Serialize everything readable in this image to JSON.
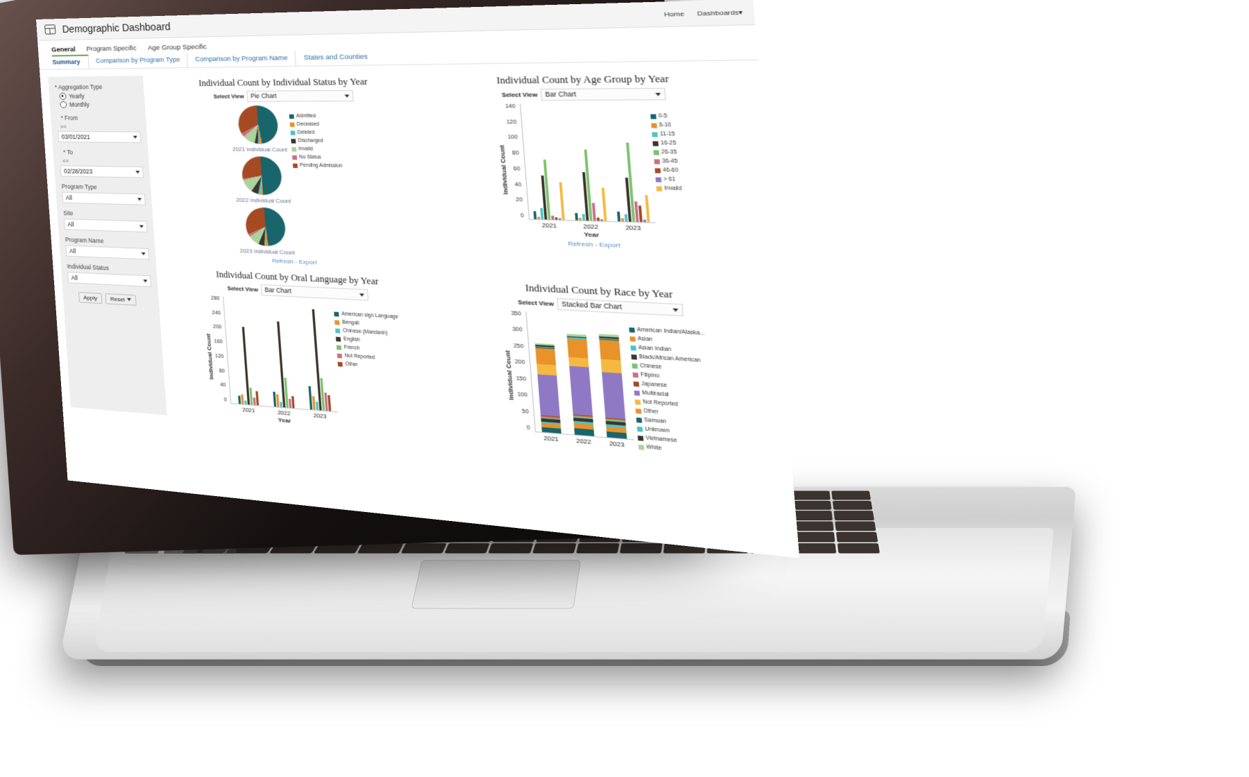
{
  "app": {
    "title": "Demographic Dashboard",
    "icon": "dashboard-grid-icon",
    "nav": {
      "home": "Home",
      "dashboards": "Dashboards",
      "caret": "▾"
    }
  },
  "tabs_primary": [
    {
      "label": "General",
      "active": true
    },
    {
      "label": "Program Specific",
      "active": false
    },
    {
      "label": "Age Group Specific",
      "active": false
    }
  ],
  "tabs_secondary": [
    {
      "label": "Summary",
      "active": true
    },
    {
      "label": "Comparison by Program Type",
      "active": false
    },
    {
      "label": "Comparison by Program Name",
      "active": false
    },
    {
      "label": "States and Counties",
      "active": false
    }
  ],
  "filters": {
    "aggregation_label": "* Aggregation Type",
    "aggregation_options": [
      {
        "label": "Yearly",
        "selected": true
      },
      {
        "label": "Monthly",
        "selected": false
      }
    ],
    "from_label": "* From",
    "from_operator": ">=",
    "from_value": "03/01/2021",
    "to_label": "* To",
    "to_operator": "<=",
    "to_value": "02/28/2023",
    "program_type_label": "Program Type",
    "program_type_value": "All",
    "site_label": "Site",
    "site_value": "All",
    "program_name_label": "Program Name",
    "program_name_value": "All",
    "individual_status_label": "Individual Status",
    "individual_status_value": "All",
    "apply_label": "Apply",
    "reset_label": "Reset"
  },
  "select_view_label": "Select View",
  "refresh_label": "Refresh",
  "export_label": "Export",
  "chart_data": [
    {
      "id": "status_pie",
      "type": "pie",
      "title": "Individual Count by Individual Status by Year",
      "view": "Pie Chart",
      "legend_position": "right",
      "legend": [
        {
          "name": "Admitted",
          "color": "#18656b"
        },
        {
          "name": "Deceased",
          "color": "#e8922a"
        },
        {
          "name": "Deleted",
          "color": "#4cc3c9"
        },
        {
          "name": "Discharged",
          "color": "#3b342e"
        },
        {
          "name": "Invalid",
          "color": "#a9d49a"
        },
        {
          "name": "No Status",
          "color": "#c96f86"
        },
        {
          "name": "Pending Admission",
          "color": "#a54a23"
        }
      ],
      "pies": [
        {
          "caption": "2021 Individual Count",
          "values": [
            {
              "name": "Admitted",
              "value": 48
            },
            {
              "name": "Deceased",
              "value": 2
            },
            {
              "name": "Deleted",
              "value": 1
            },
            {
              "name": "Discharged",
              "value": 3
            },
            {
              "name": "Invalid",
              "value": 10
            },
            {
              "name": "No Status",
              "value": 3
            },
            {
              "name": "Pending Admission",
              "value": 33
            }
          ]
        },
        {
          "caption": "2022 Individual Count",
          "values": [
            {
              "name": "Admitted",
              "value": 50
            },
            {
              "name": "Deceased",
              "value": 2
            },
            {
              "name": "Deleted",
              "value": 2
            },
            {
              "name": "Discharged",
              "value": 6
            },
            {
              "name": "Invalid",
              "value": 11
            },
            {
              "name": "No Status",
              "value": 1
            },
            {
              "name": "Pending Admission",
              "value": 28
            }
          ]
        },
        {
          "caption": "2023 Individual Count",
          "values": [
            {
              "name": "Admitted",
              "value": 49
            },
            {
              "name": "Deceased",
              "value": 2
            },
            {
              "name": "Deleted",
              "value": 1
            },
            {
              "name": "Discharged",
              "value": 5
            },
            {
              "name": "Invalid",
              "value": 9
            },
            {
              "name": "No Status",
              "value": 2
            },
            {
              "name": "Pending Admission",
              "value": 32
            }
          ]
        }
      ]
    },
    {
      "id": "agegroup_bar",
      "type": "bar",
      "title": "Individual Count by Age Group by Year",
      "view": "Bar Chart",
      "xlabel": "Year",
      "ylabel": "Individual Count",
      "ylim": [
        0,
        140
      ],
      "yticks": [
        140,
        120,
        100,
        80,
        60,
        40,
        20,
        0
      ],
      "categories": [
        "2021",
        "2022",
        "2023"
      ],
      "series": [
        {
          "name": "0-5",
          "color": "#18656b",
          "values": [
            10,
            9,
            12
          ]
        },
        {
          "name": "6-10",
          "color": "#e8922a",
          "values": [
            3,
            3,
            4
          ]
        },
        {
          "name": "11-15",
          "color": "#4cc3c9",
          "values": [
            14,
            8,
            9
          ]
        },
        {
          "name": "16-25",
          "color": "#3b342e",
          "values": [
            53,
            58,
            52
          ]
        },
        {
          "name": "26-35",
          "color": "#7cc36b",
          "values": [
            72,
            85,
            94
          ]
        },
        {
          "name": "36-45",
          "color": "#c96f86",
          "values": [
            5,
            21,
            24
          ]
        },
        {
          "name": "46-60",
          "color": "#a54a23",
          "values": [
            3,
            4,
            19
          ]
        },
        {
          "name": "> 61",
          "color": "#8f79c4",
          "values": [
            2,
            2,
            3
          ]
        },
        {
          "name": "Invalid",
          "color": "#f5b942",
          "values": [
            45,
            40,
            32
          ]
        }
      ]
    },
    {
      "id": "orallanguage_bar",
      "type": "bar",
      "title": "Individual Count by Oral Language by Year",
      "view": "Bar Chart",
      "xlabel": "Year",
      "ylabel": "Individual Count",
      "ylim": [
        0,
        280
      ],
      "yticks": [
        280,
        240,
        200,
        160,
        120,
        80,
        40,
        0
      ],
      "categories": [
        "2021",
        "2022",
        "2023"
      ],
      "legend": [
        {
          "name": "American sign Language",
          "color": "#18656b"
        },
        {
          "name": "Bengali",
          "color": "#e8922a"
        },
        {
          "name": "Chinese (Mandarin)",
          "color": "#4cc3c9"
        },
        {
          "name": "English",
          "color": "#3b342e"
        },
        {
          "name": "French",
          "color": "#7cc36b"
        },
        {
          "name": "Not Reported",
          "color": "#c96f86"
        },
        {
          "name": "Other",
          "color": "#a54a23"
        }
      ],
      "series": [
        {
          "name": "American sign Language",
          "color": "#18656b",
          "values": [
            22,
            38,
            60
          ]
        },
        {
          "name": "Bengali",
          "color": "#e8922a",
          "values": [
            26,
            32,
            34
          ]
        },
        {
          "name": "Chinese (Mandarin)",
          "color": "#4cc3c9",
          "values": [
            10,
            14,
            22
          ]
        },
        {
          "name": "English",
          "color": "#3b342e",
          "values": [
            202,
            222,
            258
          ]
        },
        {
          "name": "French",
          "color": "#7cc36b",
          "values": [
            44,
            78,
            84
          ]
        },
        {
          "name": "Not Reported",
          "color": "#c96f86",
          "values": [
            20,
            24,
            46
          ]
        },
        {
          "name": "Other",
          "color": "#a54a23",
          "values": [
            36,
            30,
            40
          ]
        }
      ]
    },
    {
      "id": "race_stacked",
      "type": "bar",
      "title": "Individual Count by Race by Year",
      "view": "Stacked Bar Chart",
      "stacked": true,
      "xlabel": "",
      "ylabel": "Individual Count",
      "ylim": [
        0,
        350
      ],
      "yticks": [
        350,
        300,
        250,
        200,
        150,
        100,
        50,
        0
      ],
      "categories": [
        "2021",
        "2022",
        "2023"
      ],
      "series": [
        {
          "name": "American Indian/Alaska...",
          "color": "#18656b",
          "values": [
            14,
            18,
            17
          ]
        },
        {
          "name": "Asian",
          "color": "#e8922a",
          "values": [
            12,
            14,
            14
          ]
        },
        {
          "name": "Asian Indian",
          "color": "#4cc3c9",
          "values": [
            5,
            7,
            6
          ]
        },
        {
          "name": "Black/African American",
          "color": "#3b342e",
          "values": [
            8,
            10,
            9
          ]
        },
        {
          "name": "Chinese",
          "color": "#7cc36b",
          "values": [
            4,
            5,
            5
          ]
        },
        {
          "name": "Filipino",
          "color": "#c96f86",
          "values": [
            3,
            3,
            3
          ]
        },
        {
          "name": "Japanese",
          "color": "#a54a23",
          "values": [
            2,
            2,
            2
          ]
        },
        {
          "name": "Multiracial",
          "color": "#8f79c4",
          "values": [
            120,
            140,
            132
          ]
        },
        {
          "name": "Not Reported",
          "color": "#f5b942",
          "values": [
            30,
            26,
            36
          ]
        },
        {
          "name": "Other",
          "color": "#e8922a",
          "values": [
            48,
            52,
            56
          ]
        },
        {
          "name": "Samoan",
          "color": "#18656b",
          "values": [
            2,
            2,
            2
          ]
        },
        {
          "name": "Unknown",
          "color": "#4cc3c9",
          "values": [
            3,
            3,
            3
          ]
        },
        {
          "name": "Vietnamese",
          "color": "#3b342e",
          "values": [
            3,
            4,
            4
          ]
        },
        {
          "name": "White",
          "color": "#a9d49a",
          "values": [
            6,
            7,
            7
          ]
        }
      ]
    }
  ]
}
